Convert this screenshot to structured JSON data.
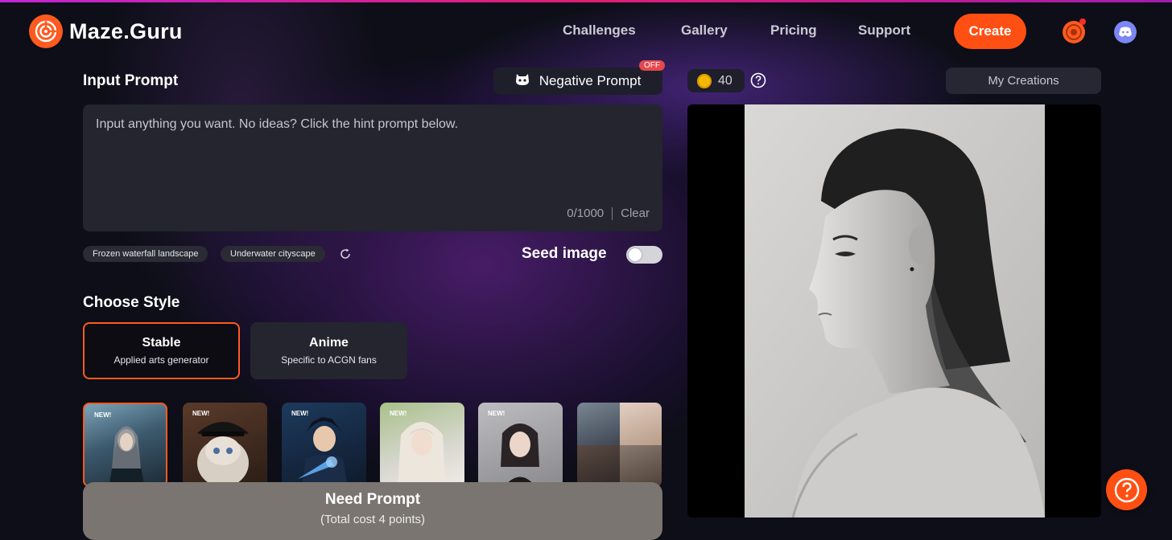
{
  "header": {
    "logo_text": "Maze.Guru",
    "nav": [
      "Challenges",
      "Gallery",
      "Pricing",
      "Support"
    ],
    "create_label": "Create"
  },
  "prompt": {
    "title": "Input Prompt",
    "negative_label": "Negative Prompt",
    "negative_badge": "OFF",
    "placeholder": "Input anything you want. No ideas? Click the hint prompt below.",
    "counter": "0/1000",
    "clear_label": "Clear",
    "hints": [
      "Frozen waterfall landscape",
      "Underwater cityscape"
    ],
    "seed_label": "Seed image",
    "seed_enabled": false
  },
  "style": {
    "title": "Choose Style",
    "options": [
      {
        "title": "Stable",
        "desc": "Applied arts generator",
        "selected": true
      },
      {
        "title": "Anime",
        "desc": "Specific to ACGN fans",
        "selected": false
      }
    ],
    "thumbnails": [
      {
        "badge": "NEW!",
        "selected": true,
        "colors": [
          "#3d5a6e",
          "#1c2a36",
          "#7ba3b8"
        ]
      },
      {
        "badge": "NEW!",
        "selected": false,
        "colors": [
          "#5a3a2a",
          "#2b1d16",
          "#c9b8a8"
        ]
      },
      {
        "badge": "NEW!",
        "selected": false,
        "colors": [
          "#1d3a5c",
          "#0f1a2c",
          "#5aa0e0"
        ]
      },
      {
        "badge": "NEW!",
        "selected": false,
        "colors": [
          "#a8c08a",
          "#d8d8d0",
          "#f0ece6"
        ]
      },
      {
        "badge": "NEW!",
        "selected": false,
        "colors": [
          "#8a8a8e",
          "#2a2426",
          "#e0d0c8"
        ]
      },
      {
        "badge": "",
        "selected": false,
        "colors": [
          "#556070",
          "#b89c88",
          "#3b3030",
          "#6a5a50"
        ]
      }
    ]
  },
  "need_prompt": {
    "title": "Need Prompt",
    "subtitle": "(Total cost 4 points)"
  },
  "right": {
    "points": "40",
    "my_creations": "My Creations"
  },
  "colors": {
    "accent": "#ff4f12",
    "panel": "#24252e",
    "background": "#0d0e17"
  }
}
